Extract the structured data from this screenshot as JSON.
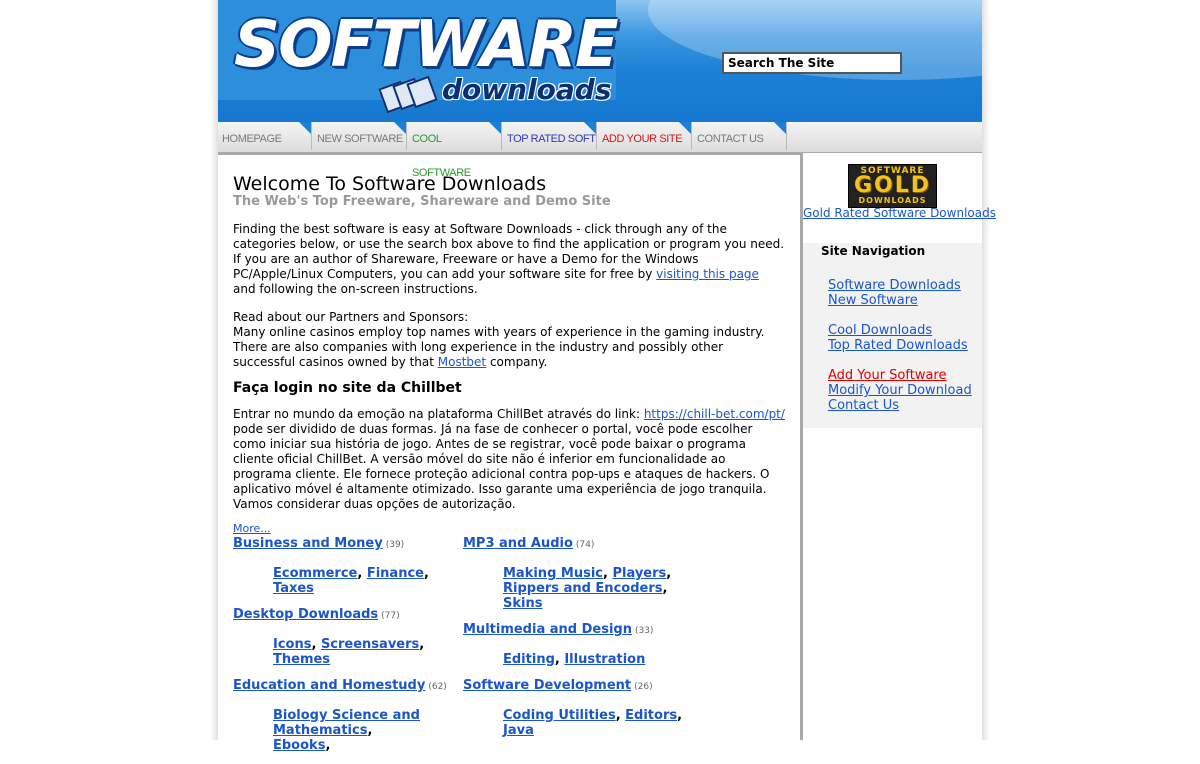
{
  "header": {
    "logo_main": "SOFTWARE",
    "logo_sub": "downloads",
    "search_placeholder": "Search The Site"
  },
  "nav": {
    "tabs": [
      {
        "label": "HOMEPAGE",
        "color": "#7a7a7a"
      },
      {
        "label": "NEW SOFTWARE",
        "color": "#7a7a7a"
      },
      {
        "label": "COOL SOFTWARE",
        "color": "#2b9a2b"
      },
      {
        "label": "TOP RATED SOFT",
        "color": "#2d3ab8"
      },
      {
        "label": "ADD YOUR SITE",
        "color": "#d01818"
      },
      {
        "label": "CONTACT US",
        "color": "#7a7a7a"
      }
    ]
  },
  "main": {
    "title": "Welcome To Software Downloads",
    "subtitle": "The Web's Top Freeware, Shareware and Demo Site",
    "intro_before_link": "Finding the best software is easy at Software Downloads - click through any of the categories below, or use the search box above to find the application or program you need. If you are an author of Shareware, Freeware or have a Demo for the Windows PC/Apple/Linux Computers, you can add your software site for free by ",
    "intro_link": "visiting this page",
    "intro_after_link": " and following the on-screen instructions.",
    "partners_heading": "Read about our Partners and Sponsors:",
    "partners_before_link": "Many online casinos employ top names with years of experience in the gaming industry. There are also companies with long experience in the industry and possibly other successful casinos owned by that ",
    "partners_link": "Mostbet",
    "partners_after_link": " company.",
    "section_title": "Faça login no site da Chillbet",
    "section_before_link": "Entrar no mundo da emoção na plataforma ChillBet através do link: ",
    "section_link": "https://chill-bet.com/pt/",
    "section_after_link": " pode ser dividido de duas formas. Já na fase de conhecer o portal, você pode escolher como iniciar sua história de jogo. Antes de se registrar, você pode baixar o programa cliente oficial ChillBet. A versão móvel do site não é inferior em funcionalidade ao programa cliente. Ele fornece proteção adicional contra pop-ups e ataques de hackers. O aplicativo móvel é altamente otimizado. Isso garante uma experiência de jogo tranquila. Vamos considerar duas opções de autorização.",
    "more_link": "More..."
  },
  "categories": {
    "left": [
      {
        "title": "Business and Money",
        "count": "(39)",
        "subs": [
          "Ecommerce",
          "Finance",
          "Taxes"
        ]
      },
      {
        "title": "Desktop Downloads",
        "count": "(77)",
        "subs": [
          "Icons",
          "Screensavers",
          "Themes"
        ]
      },
      {
        "title": "Education and Homestudy",
        "count": "(62)",
        "subs": [
          "Biology Science and Mathematics",
          "Ebooks"
        ]
      }
    ],
    "right": [
      {
        "title": "MP3 and Audio",
        "count": "(74)",
        "subs": [
          "Making Music",
          "Players",
          "Rippers and Encoders",
          "Skins"
        ]
      },
      {
        "title": "Multimedia and Design",
        "count": "(33)",
        "subs": [
          "Editing",
          "Illustration"
        ]
      },
      {
        "title": "Software Development",
        "count": "(26)",
        "subs": [
          "Coding Utilities",
          "Editors",
          "Java"
        ]
      }
    ]
  },
  "sidebar": {
    "gold_badge_top": "SOFTWARE",
    "gold_badge_mid": "GOLD",
    "gold_badge_bottom": "DOWNLOADS",
    "gold_link": "Gold Rated Software Downloads",
    "nav_title": "Site Navigation",
    "links": [
      {
        "label": "Software Downloads"
      },
      {
        "label": "New Software"
      },
      {
        "label": "Cool Downloads"
      },
      {
        "label": "Top Rated Downloads"
      },
      {
        "label": "Add Your Software"
      },
      {
        "label": "Modify Your Download"
      },
      {
        "label": "Contact Us"
      }
    ]
  }
}
